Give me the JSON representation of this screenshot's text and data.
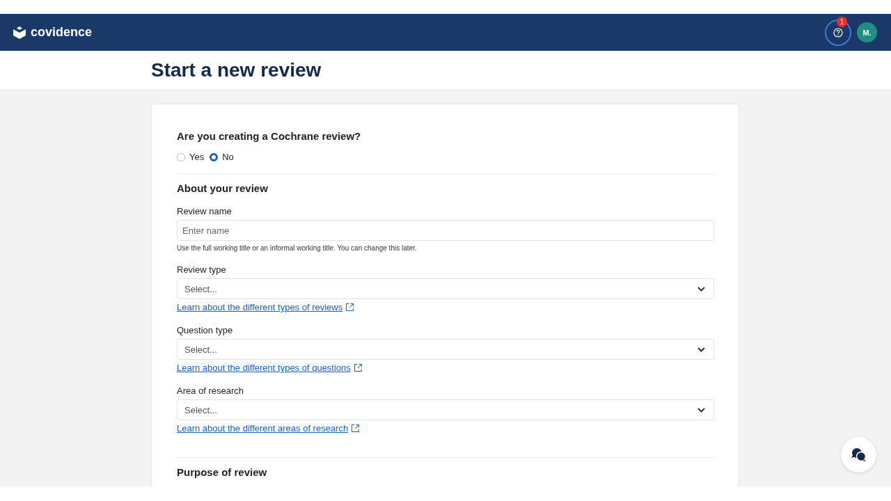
{
  "nav": {
    "logo": "covidence",
    "help_badge": "1",
    "avatar": "M."
  },
  "page_title": "Start a new review",
  "cochrane": {
    "question": "Are you creating a Cochrane review?",
    "options": [
      {
        "label": "Yes",
        "selected": false
      },
      {
        "label": "No",
        "selected": true
      }
    ]
  },
  "sections": [
    {
      "heading": "About your review",
      "fields": [
        {
          "kind": "text",
          "label": "Review name",
          "placeholder": "Enter name",
          "help": "Use the full working title or an informal working title. You can change this later."
        },
        {
          "kind": "select",
          "label": "Review type",
          "placeholder": "Select...",
          "link": "Learn about the different types of reviews"
        },
        {
          "kind": "select",
          "label": "Question type",
          "placeholder": "Select...",
          "link": "Learn about the different types of questions"
        },
        {
          "kind": "select",
          "label": "Area of research",
          "placeholder": "Select...",
          "link": "Learn about the different areas of research"
        }
      ]
    },
    {
      "heading": "Purpose of review"
    }
  ]
}
